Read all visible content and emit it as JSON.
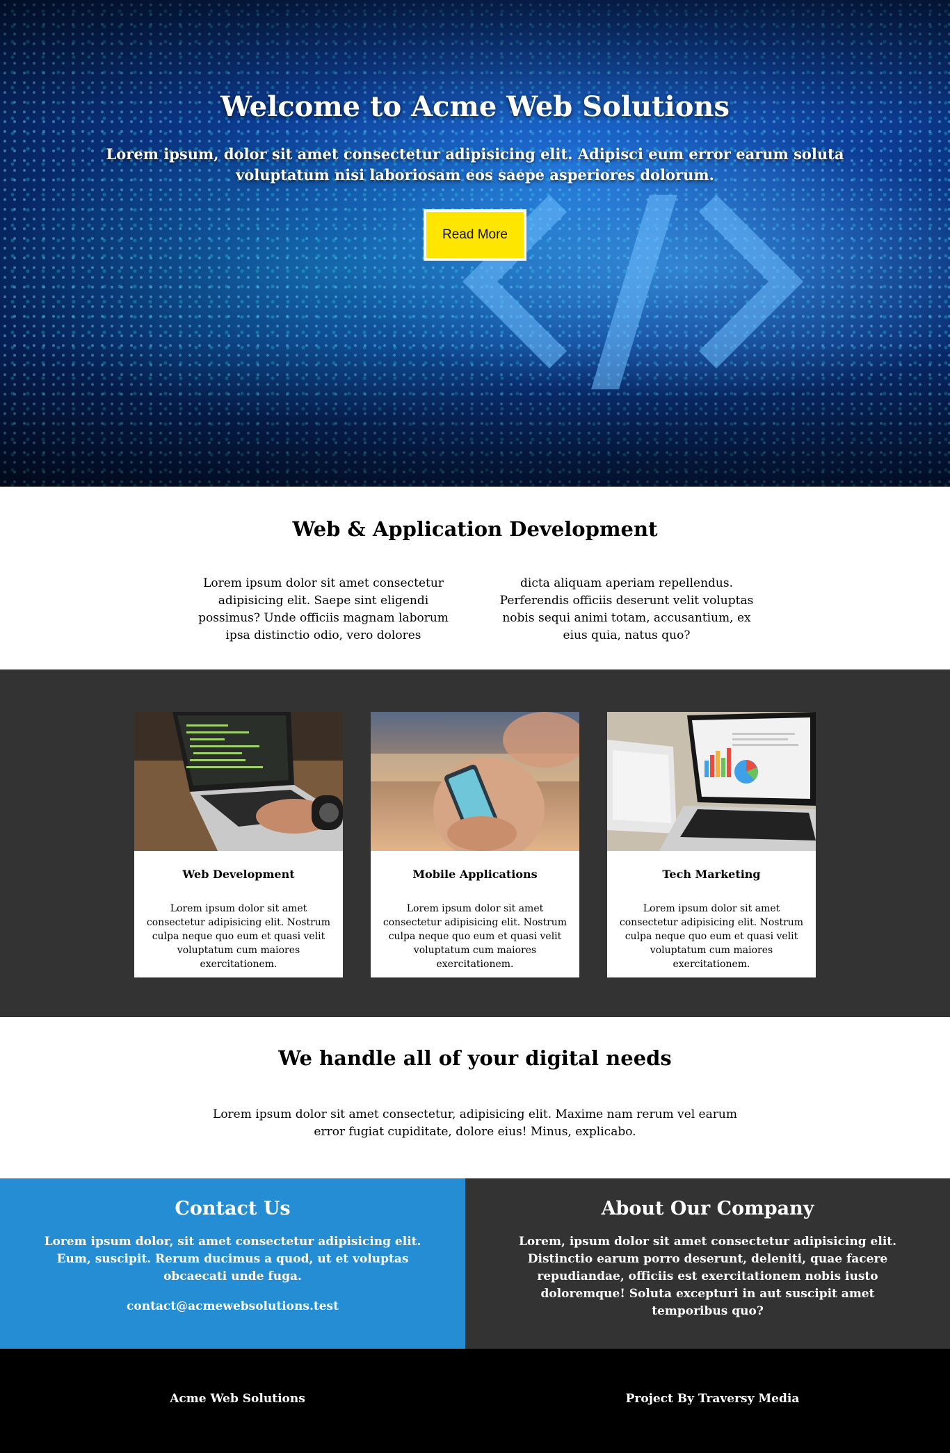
{
  "hero": {
    "title": "Welcome to Acme Web Solutions",
    "subtitle": "Lorem ipsum, dolor sit amet consectetur adipisicing elit. Adipisci eum error earum soluta voluptatum nisi laboriosam eos saepe asperiores dolorum.",
    "button_label": "Read More",
    "button_color": "#ffe600"
  },
  "dev": {
    "title": "Web & Application Development",
    "col1": "Lorem ipsum dolor sit amet consectetur adipisicing elit. Saepe sint eligendi possimus? Unde officiis magnam laborum ipsa distinctio odio, vero dolores",
    "col2": "dicta aliquam aperiam repellendus. Perferendis officiis deserunt velit voluptas nobis sequi animi totam, accusantium, ex eius quia, natus quo?"
  },
  "services": [
    {
      "title": "Web Development",
      "text": "Lorem ipsum dolor sit amet consectetur adipisicing elit. Nostrum culpa neque quo eum et quasi velit voluptatum cum maiores exercitationem.",
      "image": "laptop-coding-photo"
    },
    {
      "title": "Mobile Applications",
      "text": "Lorem ipsum dolor sit amet consectetur adipisicing elit. Nostrum culpa neque quo eum et quasi velit voluptatum cum maiores exercitationem.",
      "image": "smartphone-hands-photo"
    },
    {
      "title": "Tech Marketing",
      "text": "Lorem ipsum dolor sit amet consectetur adipisicing elit. Nostrum culpa neque quo eum et quasi velit voluptatum cum maiores exercitationem.",
      "image": "laptop-charts-photo"
    }
  ],
  "needs": {
    "title": "We handle all of your digital needs",
    "text": "Lorem ipsum dolor sit amet consectetur, adipisicing elit. Maxime nam rerum vel earum error fugiat cupiditate, dolore eius! Minus, explicabo."
  },
  "contact": {
    "title": "Contact Us",
    "text": "Lorem ipsum dolor, sit amet consectetur adipisicing elit. Eum, suscipit. Rerum ducimus a quod, ut et voluptas obcaecati unde fuga.",
    "email": "contact@acmewebsolutions.test",
    "bg_color": "#248dd3"
  },
  "about": {
    "title": "About Our Company",
    "text": "Lorem, ipsum dolor sit amet consectetur adipisicing elit. Distinctio earum porro deserunt, deleniti, quae facere repudiandae, officiis est exercitationem nobis iusto doloremque! Soluta excepturi in aut suscipit amet temporibus quo?",
    "bg_color": "#333333"
  },
  "footer": {
    "left": "Acme Web Solutions",
    "right": "Project By Traversy Media"
  }
}
